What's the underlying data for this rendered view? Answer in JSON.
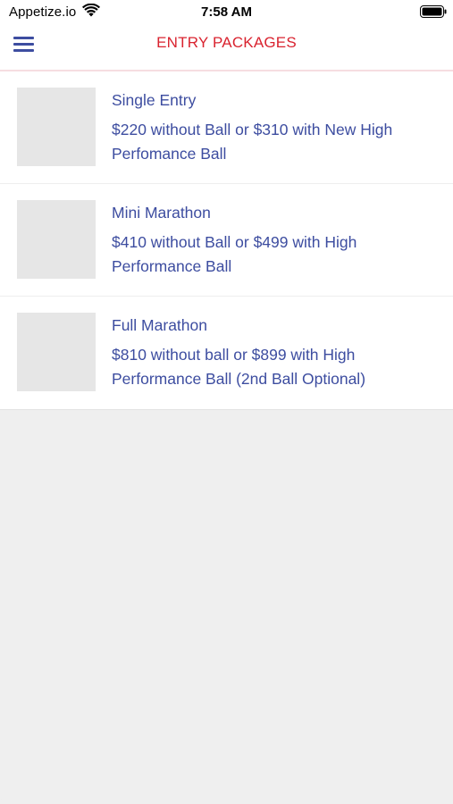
{
  "status_bar": {
    "carrier": "Appetize.io",
    "time": "7:58 AM"
  },
  "nav": {
    "title": "ENTRY PACKAGES",
    "menu_icon": "hamburger-menu-icon"
  },
  "packages": [
    {
      "title": "Single Entry",
      "description": "$220 without Ball or $310 with New High Perfomance Ball"
    },
    {
      "title": "Mini Marathon",
      "description": "$410 without Ball or $499 with High Performance Ball"
    },
    {
      "title": "Full Marathon",
      "description": "$810 without ball or $899 with High Performance Ball (2nd Ball Optional)"
    }
  ],
  "colors": {
    "title_red": "#d9232f",
    "text_blue": "#3d4da0",
    "background": "#efefef"
  }
}
